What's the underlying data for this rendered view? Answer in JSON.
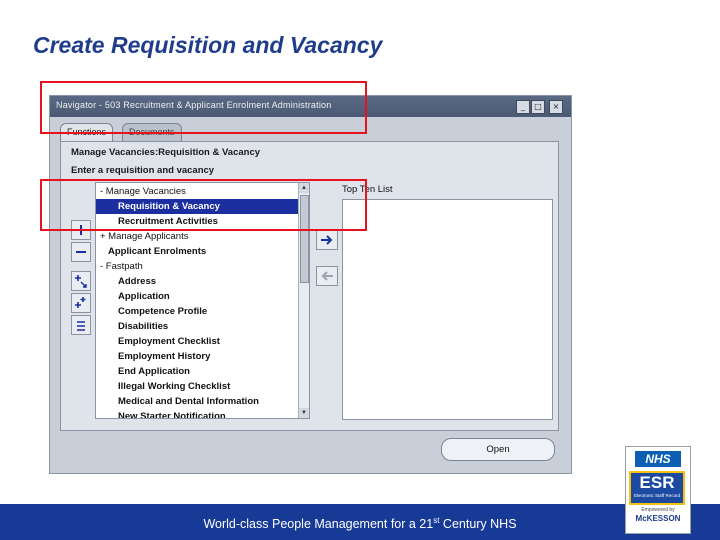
{
  "slide": {
    "title": "Create Requisition and Vacancy",
    "footer_text": "World-class People Management for a 21",
    "footer_sup": "st",
    "footer_suffix": " Century NHS"
  },
  "window": {
    "title": "Navigator - 503 Recruitment & Applicant Enrolment Administration",
    "buttons": [
      "_",
      "□",
      "×"
    ]
  },
  "tabs": [
    {
      "label": "Functions",
      "active": true
    },
    {
      "label": "Documents",
      "active": false
    }
  ],
  "panel": {
    "heading_1": "Manage Vacancies:Requisition & Vacancy",
    "heading_2": "Enter a requisition and vacancy",
    "top_list_label": "Top Ten List",
    "open_button": "Open"
  },
  "tree": [
    {
      "label": "- Manage Vacancies",
      "level": 0,
      "bold": false,
      "selected": false
    },
    {
      "label": "Requisition & Vacancy",
      "level": 2,
      "bold": true,
      "selected": true
    },
    {
      "label": "Recruitment Activities",
      "level": 2,
      "bold": true,
      "selected": false
    },
    {
      "label": "+ Manage Applicants",
      "level": 0,
      "bold": false,
      "selected": false
    },
    {
      "label": "Applicant Enrolments",
      "level": 1,
      "bold": true,
      "selected": false
    },
    {
      "label": "- Fastpath",
      "level": 0,
      "bold": false,
      "selected": false
    },
    {
      "label": "Address",
      "level": 2,
      "bold": true,
      "selected": false
    },
    {
      "label": "Application",
      "level": 2,
      "bold": true,
      "selected": false
    },
    {
      "label": "Competence Profile",
      "level": 2,
      "bold": true,
      "selected": false
    },
    {
      "label": "Disabilities",
      "level": 2,
      "bold": true,
      "selected": false
    },
    {
      "label": "Employment Checklist",
      "level": 2,
      "bold": true,
      "selected": false
    },
    {
      "label": "Employment History",
      "level": 2,
      "bold": true,
      "selected": false
    },
    {
      "label": "End Application",
      "level": 2,
      "bold": true,
      "selected": false
    },
    {
      "label": "Illegal Working Checklist",
      "level": 2,
      "bold": true,
      "selected": false
    },
    {
      "label": "Medical and Dental Information",
      "level": 2,
      "bold": true,
      "selected": false
    },
    {
      "label": "New Starter Notification",
      "level": 2,
      "bold": true,
      "selected": false
    }
  ],
  "icons": {
    "expand": "plus-icon",
    "collapse": "minus-icon",
    "expand_all": "expand-all-icon",
    "expand_branch": "expand-branch-icon",
    "collapse_all": "collapse-all-icon",
    "add_to_list": "arrow-right-icon",
    "remove_from_list": "arrow-left-icon"
  },
  "logo": {
    "nhs": "NHS",
    "esr": "ESR",
    "esr_sub": "Electronic Staff Record",
    "powered": "Empowered by",
    "mckesson": "McKESSON"
  },
  "colors": {
    "title_blue": "#1f3d8a",
    "footer_blue": "#163a96",
    "selection_blue": "#1c2fa0",
    "highlight_red": "#e8121e"
  }
}
